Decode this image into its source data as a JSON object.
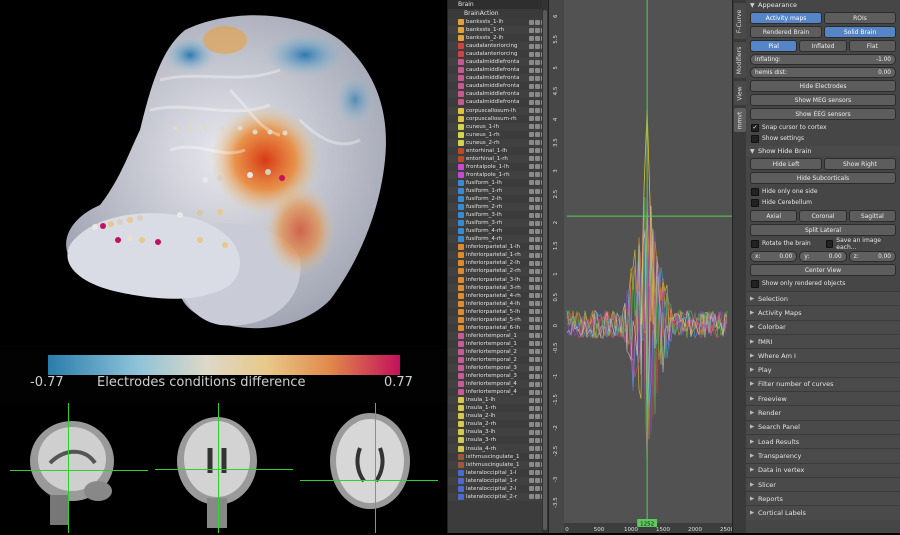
{
  "colorbar": {
    "min_label": "-0.77",
    "max_label": "0.77",
    "title": "Electrodes conditions difference"
  },
  "outliner": {
    "root": "Brain",
    "action": "BrainAction",
    "items": [
      {
        "name": "bankssts_1-lh",
        "color": "#e2a23a"
      },
      {
        "name": "bankssts_1-rh",
        "color": "#e2a23a"
      },
      {
        "name": "bankssts_2-lh",
        "color": "#e2a23a"
      },
      {
        "name": "caudalanteriorcing",
        "color": "#d34040"
      },
      {
        "name": "caudalanteriorcing",
        "color": "#d34040"
      },
      {
        "name": "caudalmiddlefronta",
        "color": "#c8568f"
      },
      {
        "name": "caudalmiddlefronta",
        "color": "#c8568f"
      },
      {
        "name": "caudalmiddlefronta",
        "color": "#c8568f"
      },
      {
        "name": "caudalmiddlefronta",
        "color": "#c8568f"
      },
      {
        "name": "caudalmiddlefronta",
        "color": "#c8568f"
      },
      {
        "name": "caudalmiddlefronta",
        "color": "#c8568f"
      },
      {
        "name": "corpuscallosum-lh",
        "color": "#e0c440"
      },
      {
        "name": "corpuscallosum-rh",
        "color": "#e0c440"
      },
      {
        "name": "cuneus_1-lh",
        "color": "#d4d44a"
      },
      {
        "name": "cuneus_1-rh",
        "color": "#d4d44a"
      },
      {
        "name": "cuneus_2-rh",
        "color": "#d4d44a"
      },
      {
        "name": "entorhinal_1-lh",
        "color": "#b94a2a"
      },
      {
        "name": "entorhinal_1-rh",
        "color": "#b94a2a"
      },
      {
        "name": "frontalpole_1-lh",
        "color": "#c64bd0"
      },
      {
        "name": "frontalpole_1-rh",
        "color": "#c64bd0"
      },
      {
        "name": "fusiform_1-lh",
        "color": "#3a8ad0"
      },
      {
        "name": "fusiform_1-rh",
        "color": "#3a8ad0"
      },
      {
        "name": "fusiform_2-lh",
        "color": "#3a8ad0"
      },
      {
        "name": "fusiform_2-rh",
        "color": "#3a8ad0"
      },
      {
        "name": "fusiform_3-lh",
        "color": "#3a8ad0"
      },
      {
        "name": "fusiform_3-rh",
        "color": "#3a8ad0"
      },
      {
        "name": "fusiform_4-rh",
        "color": "#3a8ad0"
      },
      {
        "name": "fusiform_4-rh",
        "color": "#3a8ad0"
      },
      {
        "name": "inferiorparietal_1-lh",
        "color": "#e08a2e"
      },
      {
        "name": "inferiorparietal_1-rh",
        "color": "#e08a2e"
      },
      {
        "name": "inferiorparietal_2-lh",
        "color": "#e08a2e"
      },
      {
        "name": "inferiorparietal_2-rh",
        "color": "#e08a2e"
      },
      {
        "name": "inferiorparietal_3-lh",
        "color": "#e08a2e"
      },
      {
        "name": "inferiorparietal_3-rh",
        "color": "#e08a2e"
      },
      {
        "name": "inferiorparietal_4-rh",
        "color": "#e08a2e"
      },
      {
        "name": "inferiorparietal_4-lh",
        "color": "#e08a2e"
      },
      {
        "name": "inferiorparietal_5-lh",
        "color": "#e08a2e"
      },
      {
        "name": "inferiorparietal_5-rh",
        "color": "#e08a2e"
      },
      {
        "name": "inferiorparietal_6-lh",
        "color": "#e08a2e"
      },
      {
        "name": "inferiortemporal_1",
        "color": "#c85a9a"
      },
      {
        "name": "inferiortemporal_1",
        "color": "#c85a9a"
      },
      {
        "name": "inferiortemporal_2",
        "color": "#c85a9a"
      },
      {
        "name": "inferiortemporal_2",
        "color": "#c85a9a"
      },
      {
        "name": "inferiortemporal_3",
        "color": "#c85a9a"
      },
      {
        "name": "inferiortemporal_3",
        "color": "#c85a9a"
      },
      {
        "name": "inferiortemporal_4",
        "color": "#c85a9a"
      },
      {
        "name": "inferiortemporal_4",
        "color": "#c85a9a"
      },
      {
        "name": "insula_1-lh",
        "color": "#d6c84a"
      },
      {
        "name": "insula_1-rh",
        "color": "#d6c84a"
      },
      {
        "name": "insula_2-lh",
        "color": "#d6c84a"
      },
      {
        "name": "insula_2-rh",
        "color": "#d6c84a"
      },
      {
        "name": "insula_3-lh",
        "color": "#d6c84a"
      },
      {
        "name": "insula_3-rh",
        "color": "#d6c84a"
      },
      {
        "name": "insula_4-rh",
        "color": "#d6c84a"
      },
      {
        "name": "isthmuscingulate_1",
        "color": "#9a5a3a"
      },
      {
        "name": "isthmuscingulate_1",
        "color": "#9a5a3a"
      },
      {
        "name": "lateraloccipital_1-l",
        "color": "#4a6ad0"
      },
      {
        "name": "lateraloccipital_1-r",
        "color": "#4a6ad0"
      },
      {
        "name": "lateraloccipital_2-l",
        "color": "#4a6ad0"
      },
      {
        "name": "lateraloccipital_2-r",
        "color": "#4a6ad0"
      }
    ]
  },
  "graph": {
    "y_ticks": [
      "6",
      "5.5",
      "5",
      "4.5",
      "4",
      "3.5",
      "3",
      "2.5",
      "2",
      "1.5",
      "1",
      "0.5",
      "0",
      "-0.5",
      "-1",
      "-1.5",
      "-2",
      "-2.5",
      "-3",
      "-3.5"
    ],
    "x_ticks": [
      "0",
      "500",
      "1000",
      "1500",
      "2000",
      "2500"
    ],
    "current_frame": "1252",
    "line_colors": [
      "#e04040",
      "#e0c040",
      "#8a4ad0",
      "#40a0e0",
      "#e08a2e",
      "#50c050",
      "#d050a0",
      "#c0c0c0"
    ]
  },
  "tabs": [
    "F-Curve",
    "Modifiers",
    "View",
    "mmvt"
  ],
  "props": {
    "appearance_title": "Appearance",
    "activity_maps": "Activity maps",
    "rois": "ROIs",
    "rendered_brain": "Rendered Brain",
    "solid_brain": "Solid Brain",
    "pial": "Pial",
    "inflated": "Inflated",
    "flat": "Flat",
    "inflating_label": "inflating:",
    "inflating_value": "-1.00",
    "hemis_label": "hemis dist:",
    "hemis_value": "0.00",
    "hide_electrodes": "Hide Electrodes",
    "show_meg": "Show MEG sensors",
    "show_eeg": "Show EEG sensors",
    "snap_cursor": "Snap cursor to cortex",
    "show_settings": "Show settings",
    "show_hide_title": "Show Hide Brain",
    "hide_left": "Hide Left",
    "show_right": "Show Right",
    "hide_subcorticals": "Hide Subcorticals",
    "hide_one_side": "Hide only one side",
    "hide_cerebellum": "Hide Cerebellum",
    "axial": "Axial",
    "coronal": "Coronal",
    "sagittal": "Sagittal",
    "split_lateral": "Split Lateral",
    "rotate_brain": "Rotate the brain",
    "save_image": "Save an image each...",
    "x_label": "x:",
    "x_value": "0.00",
    "y_label": "y:",
    "y_value": "0.00",
    "z_label": "z:",
    "z_value": "0.00",
    "center_view": "Center View",
    "show_rendered": "Show only rendered objects",
    "sections": [
      "Selection",
      "Activity Maps",
      "Colorbar",
      "fMRI",
      "Where Am I",
      "Play",
      "Filter number of curves",
      "Freeview",
      "Render",
      "Search Panel",
      "Load Results",
      "Transparency",
      "Data in vertex",
      "Slicer",
      "Reports",
      "Cortical Labels"
    ]
  }
}
